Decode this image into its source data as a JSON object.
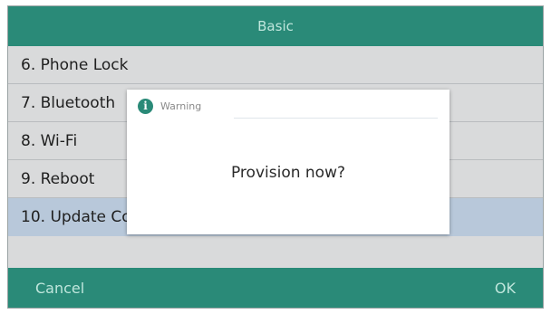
{
  "title": "Basic",
  "menu": {
    "items": [
      {
        "label": "6. Phone Lock"
      },
      {
        "label": "7. Bluetooth"
      },
      {
        "label": "8. Wi-Fi"
      },
      {
        "label": "9. Reboot"
      },
      {
        "label": "10. Update Configuration"
      }
    ],
    "selected_index": 4
  },
  "softkeys": {
    "left": "Cancel",
    "right": "OK"
  },
  "dialog": {
    "title": "Warning",
    "icon": "info-icon",
    "message": "Provision now?"
  },
  "colors": {
    "bar": "#2a8a78",
    "selected_row": "#b8c8da",
    "background": "#d9dadb"
  }
}
